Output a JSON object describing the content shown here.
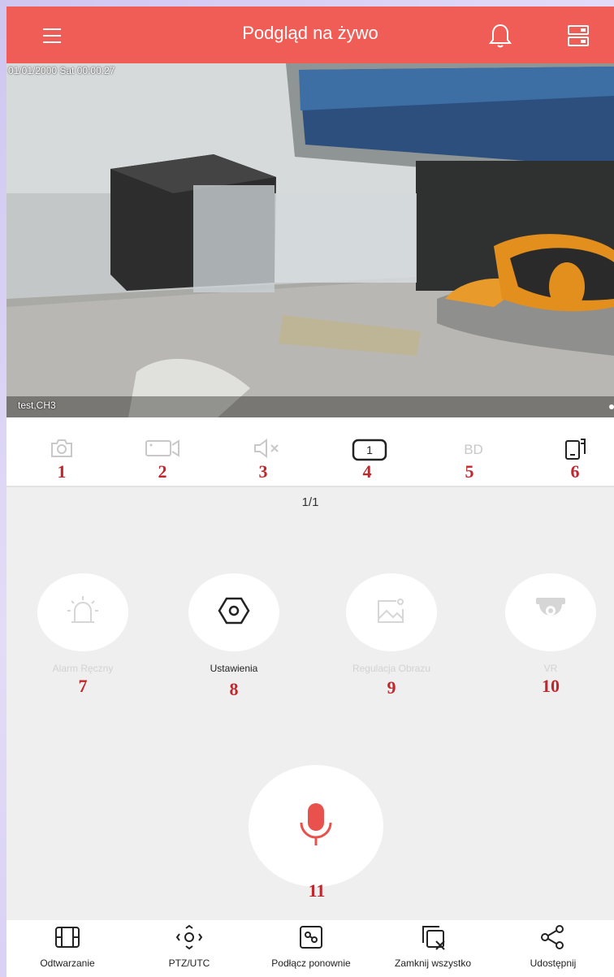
{
  "header": {
    "title": "Podgląd na żywo"
  },
  "video": {
    "timestamp": "01/01/2000 Sat 00:00:27",
    "channel_label": "test,CH3"
  },
  "toolbar": {
    "icons": [
      "camera-icon",
      "video-record-icon",
      "mute-icon",
      "split-screen-icon",
      "quality-icon",
      "rotate-icon"
    ],
    "split_value": "1",
    "quality_label": "BD",
    "numbers": [
      "1",
      "2",
      "3",
      "4",
      "5",
      "6"
    ]
  },
  "pager": "1/1",
  "functions": [
    {
      "label": "Alarm Ręczny",
      "number": "7",
      "icon": "alarm-light-icon",
      "enabled": false
    },
    {
      "label": "Ustawienia",
      "number": "8",
      "icon": "settings-icon",
      "enabled": true
    },
    {
      "label": "Regulacja Obrazu",
      "number": "9",
      "icon": "image-adjust-icon",
      "enabled": false
    },
    {
      "label": "VR",
      "number": "10",
      "icon": "vr-camera-icon",
      "enabled": false
    }
  ],
  "intercom": {
    "number": "11",
    "icon": "microphone-icon"
  },
  "bottom_nav": [
    {
      "label": "Odtwarzanie",
      "icon": "playback-film-icon"
    },
    {
      "label": "PTZ/UTC",
      "icon": "ptz-icon"
    },
    {
      "label": "Podłącz ponownie",
      "icon": "reconnect-icon"
    },
    {
      "label": "Zamknij wszystko",
      "icon": "close-all-icon"
    },
    {
      "label": "Udostępnij",
      "icon": "share-icon"
    }
  ],
  "colors": {
    "header": "#ef5d56",
    "accent": "#e8514c",
    "annotation": "#c0262c",
    "disabled": "#c8c8c8"
  }
}
